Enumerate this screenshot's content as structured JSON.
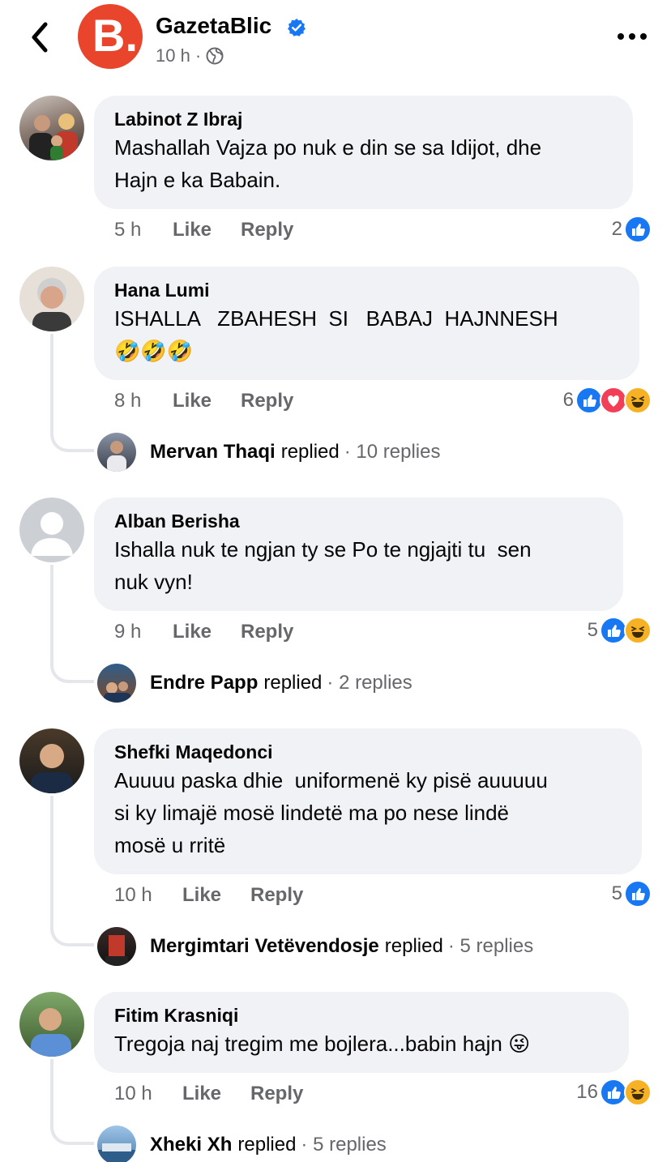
{
  "header": {
    "page_name": "GazetaBlic",
    "time": "10 h",
    "dot": "·",
    "logo_letter": "B."
  },
  "comments": [
    {
      "author": "Labinot Z Ibraj",
      "lines": [
        "Mashallah Vajza po nuk e din se sa Idijot, dhe",
        "Hajn e ka Babain."
      ],
      "time": "5 h",
      "like": "Like",
      "reply": "Reply",
      "reaction_count": "2",
      "reactions": [
        "like-icon"
      ]
    },
    {
      "author": "Hana Lumi",
      "lines": [
        "ISHALLA   ZBAHESH  SI   BABAJ  HAJNNESH",
        "🤣🤣🤣"
      ],
      "time": "8 h",
      "like": "Like",
      "reply": "Reply",
      "reaction_count": "6",
      "reactions": [
        "like-icon",
        "love-icon",
        "haha-icon"
      ],
      "replies": {
        "name": "Mervan Thaqi",
        "replied": "replied",
        "count": "· 10 replies"
      }
    },
    {
      "author": "Alban Berisha",
      "lines": [
        "Ishalla nuk te ngjan ty se Po te ngjajti tu  sen",
        "nuk vyn!"
      ],
      "time": "9 h",
      "like": "Like",
      "reply": "Reply",
      "reaction_count": "5",
      "reactions": [
        "like-icon",
        "haha-icon"
      ],
      "replies": {
        "name": "Endre Papp",
        "replied": "replied",
        "count": "· 2 replies"
      }
    },
    {
      "author": "Shefki Maqedonci",
      "lines": [
        "Auuuu paska dhie  uniformenë ky pisë auuuuu",
        "si ky limajë mosë lindetë ma po nese lindë",
        "mosë u rritë"
      ],
      "time": "10 h",
      "like": "Like",
      "reply": "Reply",
      "reaction_count": "5",
      "reactions": [
        "like-icon"
      ],
      "replies": {
        "name": "Mergimtari Vetëvendosje",
        "replied": "replied",
        "count": "· 5 replies"
      }
    },
    {
      "author": "Fitim Krasniqi",
      "lines": [
        "Tregoja naj tregim me bojlera...babin hajn 😜"
      ],
      "time": "10 h",
      "like": "Like",
      "reply": "Reply",
      "reaction_count": "16",
      "reactions": [
        "like-icon",
        "haha-icon"
      ],
      "replies": {
        "name": "Xheki Xh",
        "replied": "replied",
        "count": "· 5 replies"
      }
    }
  ],
  "colors": {
    "brand": "#e8452c",
    "like": "#1877f2",
    "love": "#f33e58",
    "haha": "#f7b125",
    "bubble": "#f0f2f5",
    "secondary_text": "#65676b"
  }
}
